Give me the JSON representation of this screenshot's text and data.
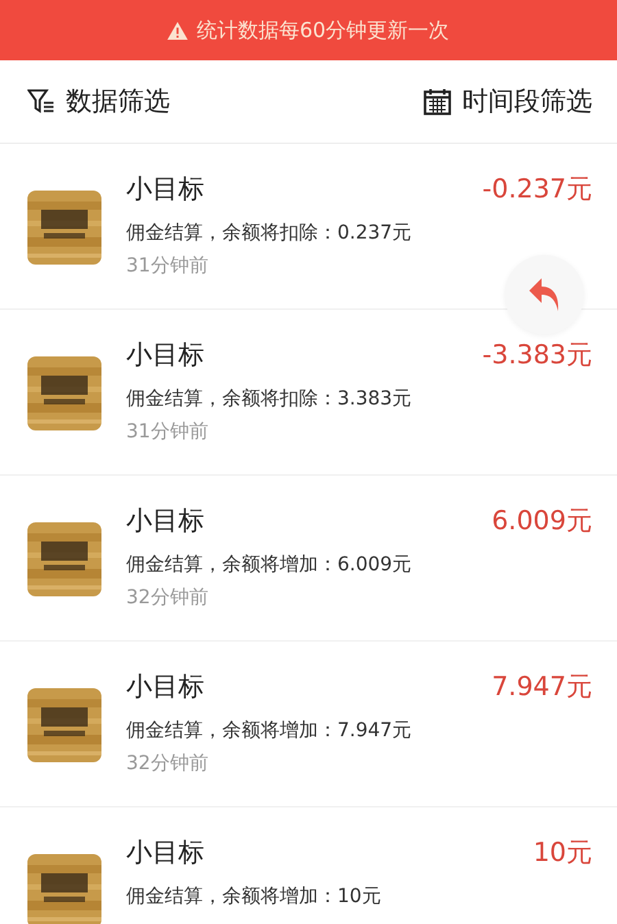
{
  "banner": {
    "text": "统计数据每60分钟更新一次"
  },
  "filters": [
    {
      "label": "数据筛选",
      "kind": "filter"
    },
    {
      "label": "时间段筛选",
      "kind": "calendar"
    }
  ],
  "records": [
    {
      "title": "小目标",
      "amount": "-0.237元",
      "description": "佣金结算，余额将扣除：0.237元",
      "time": "31分钟前"
    },
    {
      "title": "小目标",
      "amount": "-3.383元",
      "description": "佣金结算，余额将扣除：3.383元",
      "time": "31分钟前"
    },
    {
      "title": "小目标",
      "amount": "6.009元",
      "description": "佣金结算，余额将增加：6.009元",
      "time": "32分钟前"
    },
    {
      "title": "小目标",
      "amount": "7.947元",
      "description": "佣金结算，余额将增加：7.947元",
      "time": "32分钟前"
    },
    {
      "title": "小目标",
      "amount": "10元",
      "description": "佣金结算，余额将增加：10元"
    }
  ]
}
